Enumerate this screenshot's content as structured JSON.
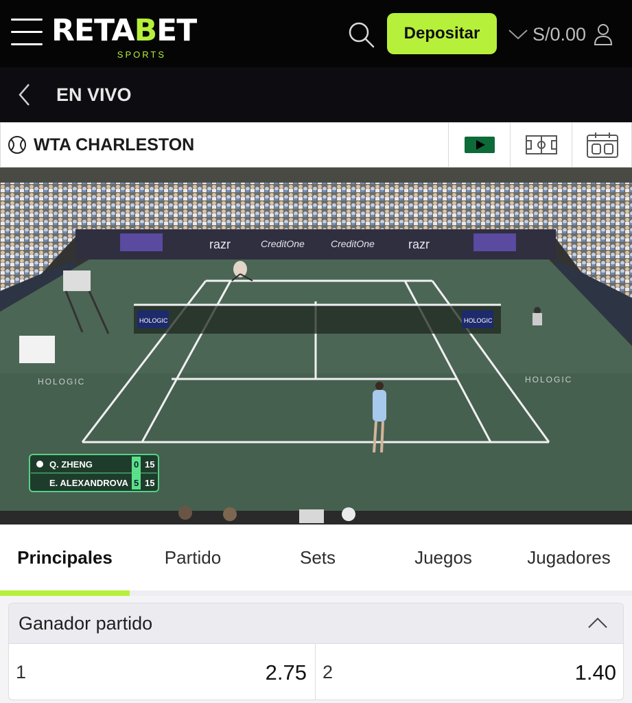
{
  "header": {
    "logo_main_a": "RETA",
    "logo_main_b": "B",
    "logo_main_c": "ET",
    "logo_sub": "SPORTS",
    "deposit_label": "Depositar",
    "balance": "S/0.00",
    "icons": [
      "menu-icon",
      "search-icon",
      "chevron-down-icon",
      "user-icon"
    ],
    "accent_color": "#b6f03a"
  },
  "subheader": {
    "title": "EN VIVO",
    "icons": [
      "back-arrow-icon"
    ]
  },
  "event": {
    "title": "WTA CHARLESTON",
    "sport_icon": "tennis-ball-icon",
    "buttons": [
      "play-video-icon",
      "court-field-icon",
      "scoreboard-icon"
    ]
  },
  "video": {
    "board_texts": [
      "razr",
      "CreditOne",
      "CreditOne",
      "razr",
      "HOLOGIC",
      "HOLOGIC",
      "HOLOGIC",
      "HOLOGIC"
    ],
    "scoreboard": [
      {
        "player": "Q. ZHENG",
        "sets": "0",
        "points": "15",
        "serving": true
      },
      {
        "player": "E. ALEXANDROVA",
        "sets": "5",
        "points": "15",
        "serving": false
      }
    ]
  },
  "tabs": [
    {
      "label": "Principales",
      "active": true
    },
    {
      "label": "Partido",
      "active": false
    },
    {
      "label": "Sets",
      "active": false
    },
    {
      "label": "Juegos",
      "active": false
    },
    {
      "label": "Jugadores",
      "active": false
    }
  ],
  "market": {
    "title": "Ganador partido",
    "expanded": true,
    "outcomes": [
      {
        "label": "1",
        "odds": "2.75"
      },
      {
        "label": "2",
        "odds": "1.40"
      }
    ]
  }
}
